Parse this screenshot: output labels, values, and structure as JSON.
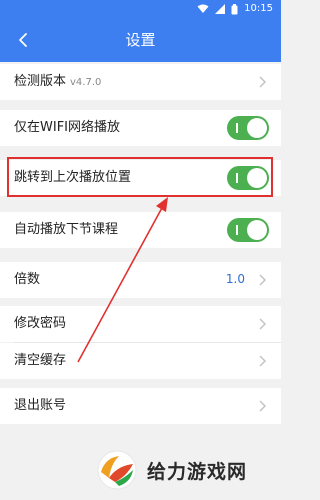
{
  "status": {
    "time": "10:15"
  },
  "header": {
    "title": "设置"
  },
  "rows": {
    "check_version": {
      "label": "检测版本",
      "version": "v4.7.0"
    },
    "wifi_only": {
      "label": "仅在WIFI网络播放",
      "on": true
    },
    "resume_position": {
      "label": "跳转到上次播放位置",
      "on": true
    },
    "autoplay_next": {
      "label": "自动播放下节课程",
      "on": true
    },
    "speed": {
      "label": "倍数",
      "value": "1.0"
    },
    "change_password": {
      "label": "修改密码"
    },
    "clear_cache": {
      "label": "清空缓存"
    },
    "logout": {
      "label": "退出账号"
    }
  },
  "watermark": {
    "text": "给力游戏网"
  },
  "colors": {
    "primary": "#3d7ff0",
    "toggle_on": "#4caf50",
    "highlight": "#e0312f",
    "background": "#f1f1f1"
  }
}
